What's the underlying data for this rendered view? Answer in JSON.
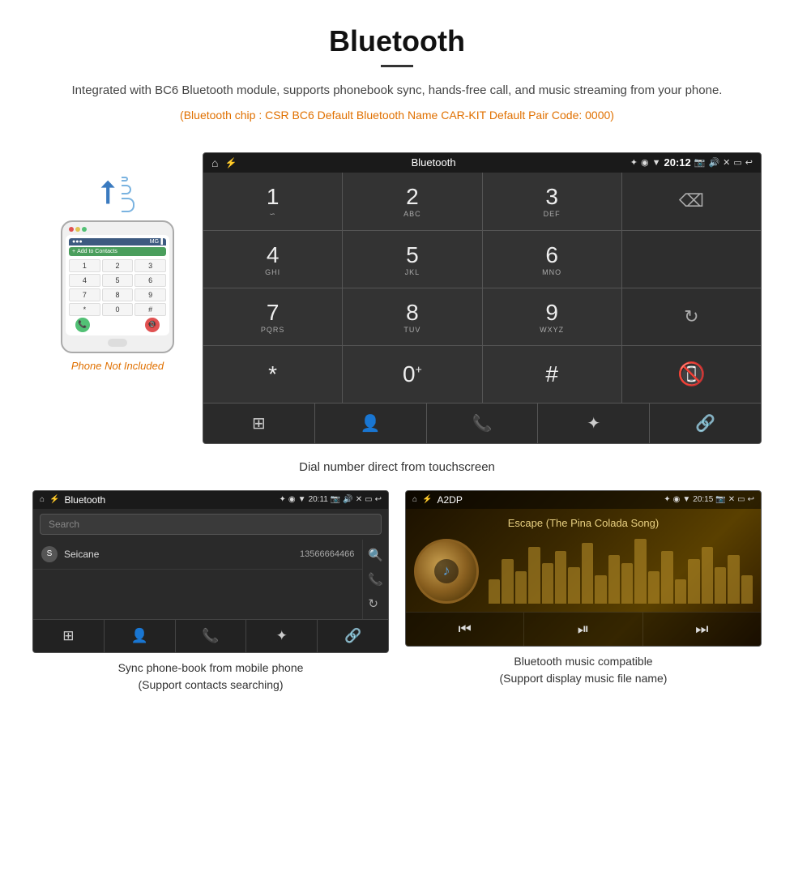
{
  "header": {
    "title": "Bluetooth",
    "description": "Integrated with BC6 Bluetooth module, supports phonebook sync, hands-free call, and music streaming from your phone.",
    "specs": "(Bluetooth chip : CSR BC6    Default Bluetooth Name CAR-KIT    Default Pair Code: 0000)"
  },
  "phone_area": {
    "not_included_label": "Phone Not Included"
  },
  "car_screen": {
    "title": "Bluetooth",
    "time": "20:12",
    "dialpad": {
      "keys": [
        {
          "num": "1",
          "sub": ""
        },
        {
          "num": "2",
          "sub": "ABC"
        },
        {
          "num": "3",
          "sub": "DEF"
        },
        {
          "num": "4",
          "sub": "GHI"
        },
        {
          "num": "5",
          "sub": "JKL"
        },
        {
          "num": "6",
          "sub": "MNO"
        },
        {
          "num": "7",
          "sub": "PQRS"
        },
        {
          "num": "8",
          "sub": "TUV"
        },
        {
          "num": "9",
          "sub": "WXYZ"
        },
        {
          "num": "*",
          "sub": ""
        },
        {
          "num": "0",
          "sub": "+"
        },
        {
          "num": "#",
          "sub": ""
        }
      ]
    }
  },
  "dial_caption": "Dial number direct from touchscreen",
  "contacts_screen": {
    "title": "Bluetooth",
    "time": "20:11",
    "search_placeholder": "Search",
    "contact": {
      "letter": "S",
      "name": "Seicane",
      "number": "13566664466"
    }
  },
  "music_screen": {
    "title": "A2DP",
    "time": "20:15",
    "song_title": "Escape (The Pina Colada Song)"
  },
  "bottom_captions": {
    "contacts": "Sync phone-book from mobile phone\n(Support contacts searching)",
    "music": "Bluetooth music compatible\n(Support display music file name)"
  },
  "equalizer_bars": [
    30,
    55,
    40,
    70,
    50,
    65,
    45,
    75,
    35,
    60,
    50,
    80,
    40,
    65,
    30,
    55,
    70,
    45,
    60,
    35
  ]
}
